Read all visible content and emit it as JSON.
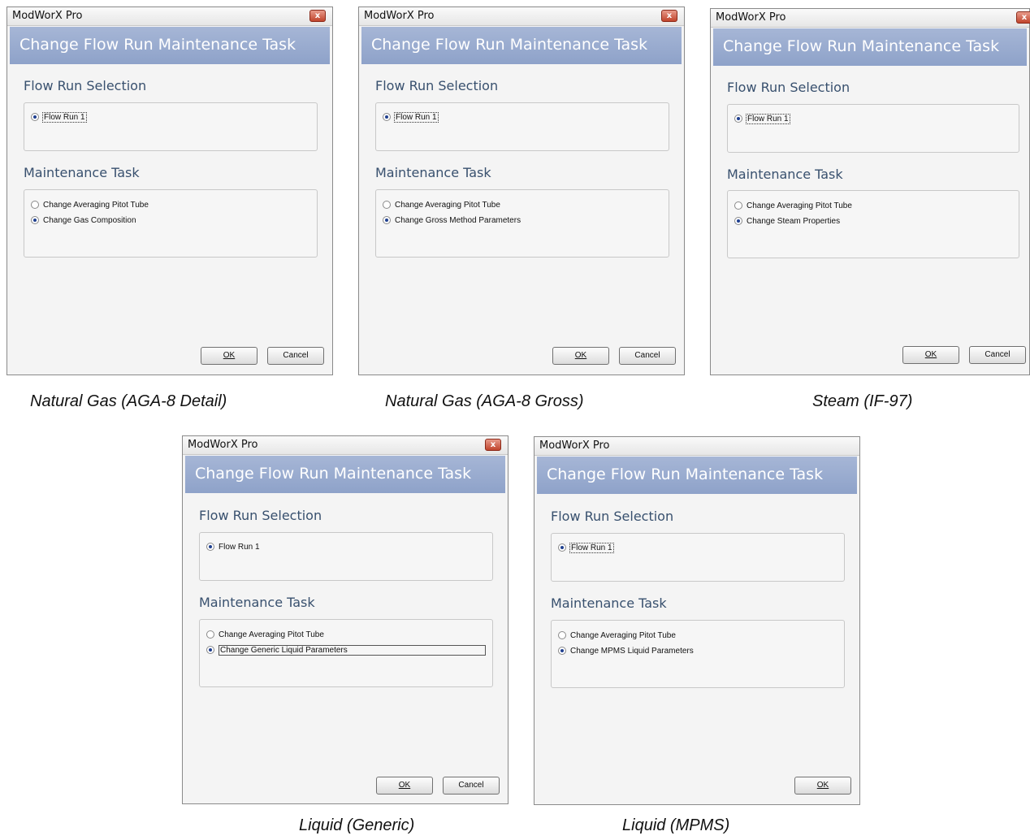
{
  "app_title": "ModWorX Pro",
  "close_glyph": "x",
  "dialog_title": "Change Flow Run Maintenance Task",
  "flow_run_heading": "Flow Run Selection",
  "maintenance_heading": "Maintenance Task",
  "flow_run_option": "Flow Run 1",
  "pitot_option": "Change Averaging Pitot Tube",
  "ok_label": "OK",
  "cancel_label": "Cancel",
  "dialogs": [
    {
      "caption": "Natural Gas (AGA-8 Detail)",
      "second_option": "Change Gas Composition"
    },
    {
      "caption": "Natural Gas (AGA-8 Gross)",
      "second_option": "Change Gross Method Parameters"
    },
    {
      "caption": "Steam (IF-97)",
      "second_option": "Change Steam Properties"
    },
    {
      "caption": "Liquid (Generic)",
      "second_option": "Change Generic Liquid Parameters"
    },
    {
      "caption": "Liquid (MPMS)",
      "second_option": "Change MPMS Liquid Parameters"
    }
  ],
  "colors": {
    "banner": "#98aacf",
    "heading": "#38506e",
    "close": "#c0442c"
  }
}
